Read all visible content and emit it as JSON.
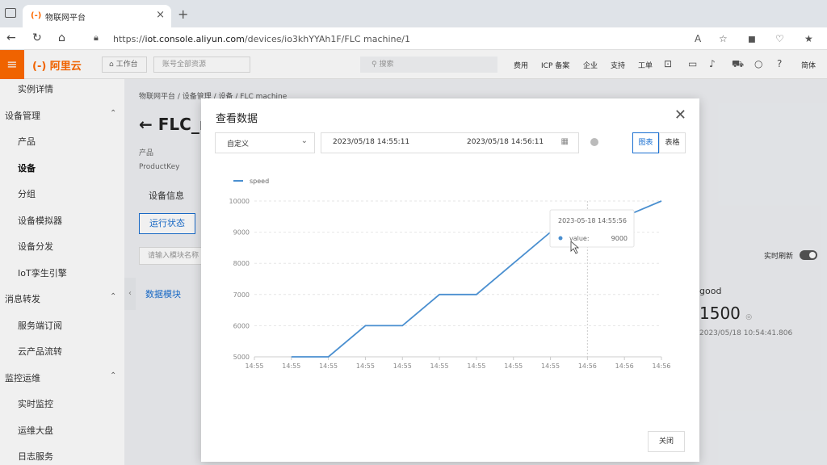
{
  "browser": {
    "tab_title": "物联网平台",
    "tab_favicon": "(-)",
    "url_prefix": "https://",
    "url_host": "iot.console.aliyun.com",
    "url_path": "/devices/io3khYYAh1F/FLC machine/1"
  },
  "header": {
    "logo": "(-) 阿里云",
    "workbench": "工作台",
    "account": "账号全部资源",
    "search_placeholder": "搜索",
    "links": [
      "费用",
      "ICP 备案",
      "企业",
      "支持",
      "工单",
      "简体"
    ]
  },
  "sidebar": {
    "items": [
      {
        "label": "实例详情",
        "type": "item"
      },
      {
        "label": "设备管理",
        "type": "group"
      },
      {
        "label": "产品",
        "type": "item"
      },
      {
        "label": "设备",
        "type": "item",
        "active": true
      },
      {
        "label": "分组",
        "type": "item"
      },
      {
        "label": "设备模拟器",
        "type": "item"
      },
      {
        "label": "设备分发",
        "type": "item"
      },
      {
        "label": "IoT孪生引擎",
        "type": "item"
      },
      {
        "label": "消息转发",
        "type": "group"
      },
      {
        "label": "服务端订阅",
        "type": "item"
      },
      {
        "label": "云产品流转",
        "type": "item"
      },
      {
        "label": "监控运维",
        "type": "group"
      },
      {
        "label": "实时监控",
        "type": "item"
      },
      {
        "label": "运维大盘",
        "type": "item"
      },
      {
        "label": "日志服务",
        "type": "item"
      }
    ]
  },
  "page": {
    "breadcrumb": "物联网平台 / 设备管理 / 设备 / FLC machine",
    "title": "FLC_r",
    "product_label": "产品",
    "productkey_label": "ProductKey",
    "device_info_tab": "设备信息",
    "run_status_btn": "运行状态",
    "input_placeholder": "请输入模块名称",
    "data_module": "数据模块",
    "realtime_label": "实时刷新",
    "property_name": "good",
    "property_value": "1500",
    "property_time": "2023/05/18 10:54:41.806"
  },
  "modal": {
    "title": "查看数据",
    "range_select": "自定义",
    "date_start": "2023/05/18 14:55:11",
    "date_end": "2023/05/18 14:56:11",
    "view_chart": "图表",
    "view_table": "表格",
    "close_button": "关闭",
    "tooltip": {
      "time": "2023-05-18 14:55:56",
      "label": "value:",
      "value": "9000"
    }
  },
  "chart_data": {
    "type": "line",
    "series": [
      {
        "name": "speed",
        "color": "#4a8fd0",
        "points": [
          [
            1,
            5000
          ],
          [
            2,
            5000
          ],
          [
            3,
            6000
          ],
          [
            4,
            6000
          ],
          [
            5,
            7000
          ],
          [
            6,
            7000
          ],
          [
            7,
            8000
          ],
          [
            8,
            9000
          ],
          [
            9,
            9000
          ],
          [
            10,
            9500
          ],
          [
            11,
            10000
          ]
        ]
      }
    ],
    "x_tick_labels": [
      "14:55",
      "14:55",
      "14:55",
      "14:55",
      "14:55",
      "14:55",
      "14:55",
      "14:55",
      "14:55",
      "14:56",
      "14:56",
      "14:56"
    ],
    "y_ticks": [
      5000,
      6000,
      7000,
      8000,
      9000,
      10000
    ],
    "ylim": [
      5000,
      10000
    ],
    "legend": "top-left",
    "grid": true
  }
}
